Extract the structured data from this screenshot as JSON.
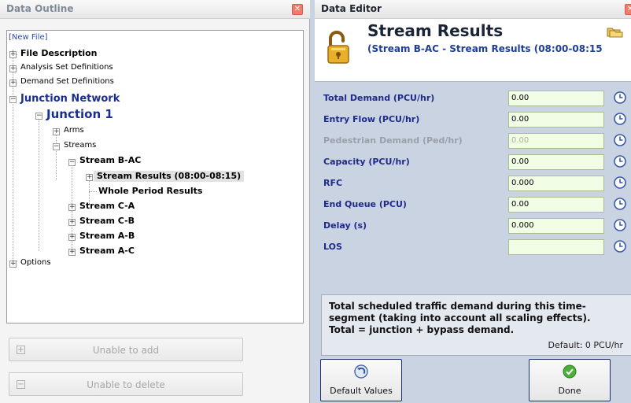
{
  "outline": {
    "title": "Data Outline",
    "close_glyph": "✕",
    "tree": {
      "new_file": "[New File]",
      "file_description": "File Description",
      "analysis_set_definitions": "Analysis Set Definitions",
      "demand_set_definitions": "Demand Set Definitions",
      "junction_network": "Junction Network",
      "junction_1": "Junction 1",
      "arms": "Arms",
      "streams": "Streams",
      "stream_b_ac": "Stream B-AC",
      "stream_results": "Stream Results (08:00-08:15)",
      "whole_period_results": "Whole Period Results",
      "stream_c_a": "Stream C-A",
      "stream_c_b": "Stream C-B",
      "stream_a_b": "Stream A-B",
      "stream_a_c": "Stream A-C",
      "options": "Options"
    },
    "add_button_label": "Unable to add",
    "delete_button_label": "Unable to delete"
  },
  "editor": {
    "title": "Data Editor",
    "close_glyph": "✕",
    "header_title": "Stream Results",
    "header_subtitle": "(Stream B-AC - Stream Results (08:00-08:15",
    "fields": [
      {
        "label": "Total Demand (PCU/hr)",
        "value": "0.00"
      },
      {
        "label": "Entry Flow (PCU/hr)",
        "value": "0.00"
      },
      {
        "label": "Pedestrian Demand (Ped/hr)",
        "value": "0.00"
      },
      {
        "label": "Capacity (PCU/hr)",
        "value": "0.00"
      },
      {
        "label": "RFC",
        "value": "0.000"
      },
      {
        "label": "End Queue (PCU)",
        "value": "0.00"
      },
      {
        "label": "Delay (s)",
        "value": "0.000"
      },
      {
        "label": "LOS",
        "value": ""
      }
    ],
    "description": "Total scheduled traffic demand during this time-segment (taking into account all scaling effects).  Total = junction + bypass demand.",
    "default_text": "Default: 0 PCU/hr",
    "default_values_button": "Default Values",
    "done_button": "Done"
  },
  "colors": {
    "accent_blue": "#1b2f93",
    "field_bg": "#f2fde6",
    "done_green": "#4caf3a",
    "lock_gold": "#e0a11a"
  }
}
